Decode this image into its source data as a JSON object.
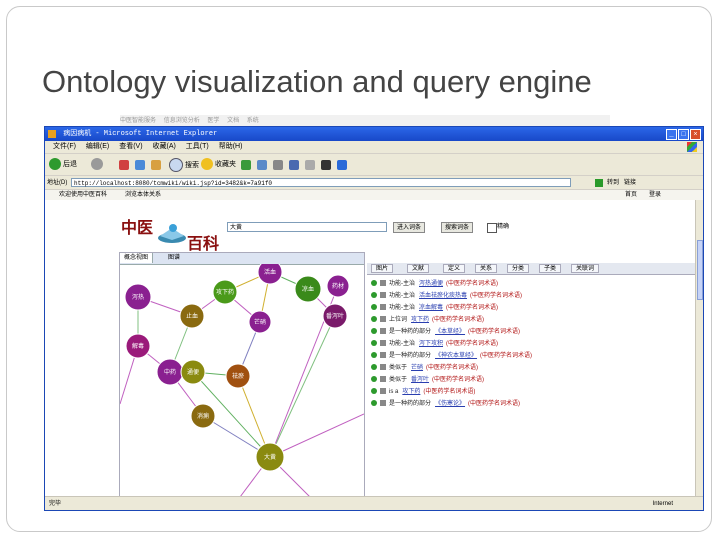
{
  "slide": {
    "title": "Ontology visualization and query engine"
  },
  "ghost_bar": [
    "中医智能服务",
    "信息浏览分析",
    "医学",
    "文档",
    "系统"
  ],
  "browser": {
    "title": "病因病机 - Microsoft Internet Explorer",
    "menu": [
      "文件(F)",
      "编辑(E)",
      "查看(V)",
      "收藏(A)",
      "工具(T)",
      "帮助(H)"
    ],
    "toolbar": {
      "back": "后退",
      "search": "搜索",
      "favorites": "收藏夹"
    },
    "address_label": "地址(D)",
    "address_value": "http://localhost:8080/tcmwiki/wiki.jsp?id=3482&k=7a91f0",
    "go_label": "转到",
    "links_label": "链接",
    "links": [
      "欢迎使用中医百科",
      "浏览本体关系"
    ],
    "links_right": [
      "首页",
      "登录"
    ],
    "status_left": "完毕",
    "status_right": "Internet",
    "colors": {
      "title_bar": "#1848c8",
      "chrome": "#ece9d8"
    }
  },
  "page": {
    "logo_top": "中医",
    "logo_bottom": "百科",
    "search_value": "大黄",
    "search_buttons": [
      "进入词条",
      "搜索词条"
    ],
    "checkbox_label": "精确",
    "graph_tabs": [
      "概念视图",
      "图谱"
    ],
    "relation_tabs": [
      "图片",
      "文献",
      "定义",
      "关系",
      "分类",
      "子类",
      "关联词"
    ],
    "relations": [
      {
        "rel": "功能-主治",
        "target": "泻热通便",
        "source": "(中医药学名词术语)"
      },
      {
        "rel": "功能-主治",
        "target": "活血祛瘀化痰热毒",
        "source": "(中医药学名词术语)"
      },
      {
        "rel": "功能-主治",
        "target": "凉血解毒",
        "source": "(中医药学名词术语)"
      },
      {
        "rel": "上位词",
        "target": "攻下药",
        "source": "(中医药学名词术语)"
      },
      {
        "rel": "是一种药的部分",
        "target": "《本草经》",
        "source": "(中医药学名词术语)"
      },
      {
        "rel": "功能-主治",
        "target": "泻下攻积",
        "source": "(中医药学名词术语)"
      },
      {
        "rel": "是一种药的部分",
        "target": "《神农本草经》",
        "source": "(中医药学名词术语)"
      },
      {
        "rel": "类似于",
        "target": "芒硝",
        "source": "(中医药学名词术语)"
      },
      {
        "rel": "类似于",
        "target": "番泻叶",
        "source": "(中医药学名词术语)"
      },
      {
        "rel": "is a",
        "target": "攻下药",
        "source": "(中医药学名词术语)"
      },
      {
        "rel": "是一种药的部分",
        "target": "《伤寒论》",
        "source": "(中医药学名词术语)"
      }
    ],
    "graph_nodes": [
      {
        "label": "泻热",
        "color": "#8a2090"
      },
      {
        "label": "大黄",
        "color": "#8a8a10"
      },
      {
        "label": "攻下药",
        "color": "#4a9a1a"
      },
      {
        "label": "芒硝",
        "color": "#8a2090"
      },
      {
        "label": "番泻叶",
        "color": "#7a1a6a"
      },
      {
        "label": "活血",
        "color": "#8a2090"
      },
      {
        "label": "凉血",
        "color": "#3a8a1a"
      },
      {
        "label": "止血",
        "color": "#8a6a10"
      },
      {
        "label": "中药",
        "color": "#8a2090"
      },
      {
        "label": "解毒",
        "color": "#9a1a7a"
      },
      {
        "label": "祛瘀",
        "color": "#a05010"
      },
      {
        "label": "通便",
        "color": "#8a8a10"
      },
      {
        "label": "消痈",
        "color": "#8a6a10"
      },
      {
        "label": "药材",
        "color": "#8a2090"
      }
    ]
  }
}
